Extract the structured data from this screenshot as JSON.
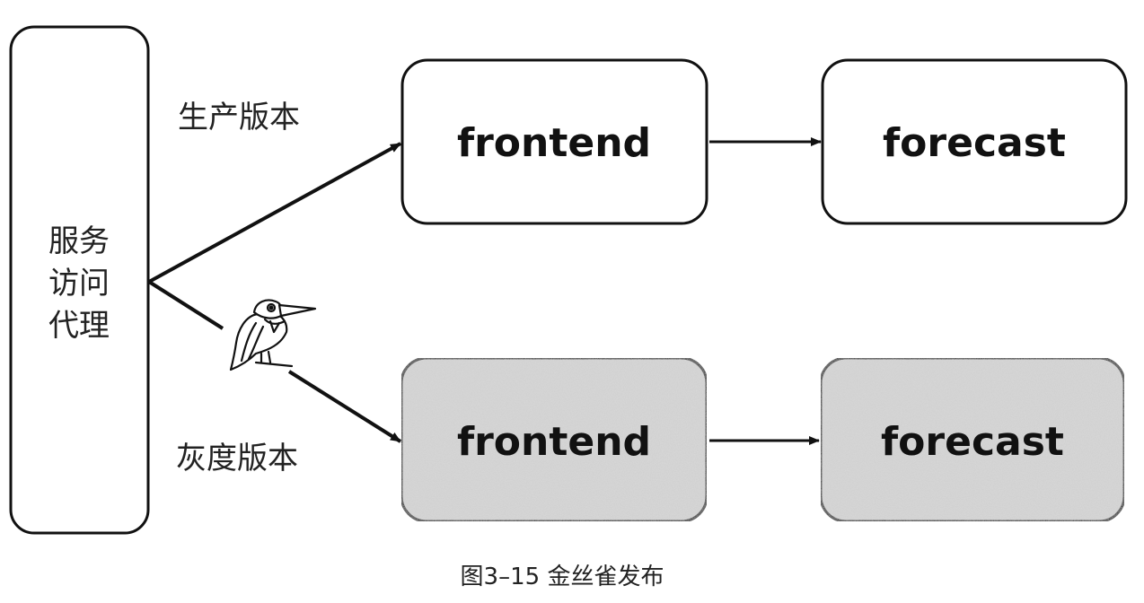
{
  "proxy": {
    "lines": [
      "服务",
      "访问",
      "代理"
    ]
  },
  "labels": {
    "production": "生产版本",
    "canary": "灰度版本"
  },
  "production_row": {
    "frontend": "frontend",
    "forecast": "forecast"
  },
  "canary_row": {
    "frontend": "frontend",
    "forecast": "forecast"
  },
  "icons": {
    "bird": "kingfisher-bird-icon"
  },
  "caption": "图3–15 金丝雀发布",
  "colors": {
    "stroke": "#111111",
    "canary_fill": "#d9d9d9"
  }
}
